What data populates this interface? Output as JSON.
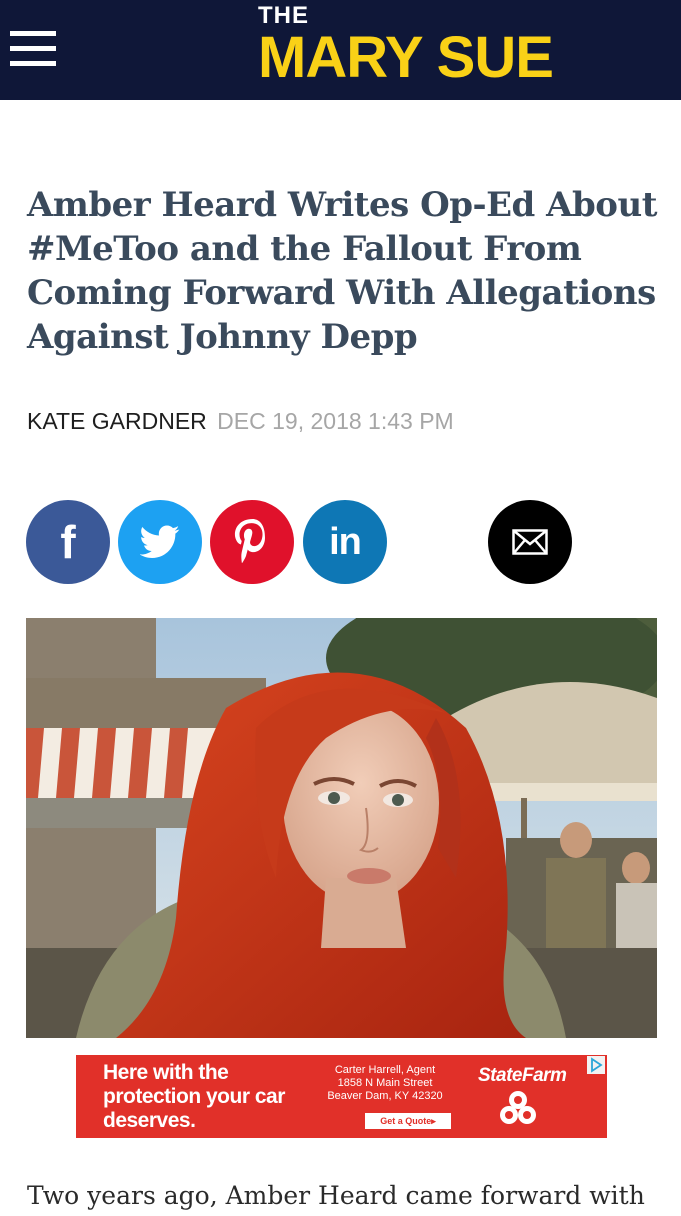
{
  "header": {
    "logo_top": "THE",
    "logo_name": "MARY SUE",
    "colors": {
      "bar": "#0f1738",
      "logo_accent": "#f9d117"
    }
  },
  "article": {
    "title": "Amber Heard Writes Op-Ed About #MeToo and the Fallout From Coming Forward With Allegations Against Johnny Depp",
    "author": "KATE GARDNER",
    "date": "DEC 19, 2018 1:43 PM",
    "body_first_line": "Two years ago, Amber Heard came forward with"
  },
  "share": [
    {
      "network": "facebook",
      "icon": "facebook-icon",
      "color": "#3b5998"
    },
    {
      "network": "twitter",
      "icon": "twitter-bird-icon",
      "color": "#1da1f2"
    },
    {
      "network": "pinterest",
      "icon": "pinterest-icon",
      "color": "#e0112b"
    },
    {
      "network": "linkedin",
      "icon": "linkedin-icon",
      "color": "#0e77b5"
    },
    {
      "network": "email",
      "icon": "envelope-icon",
      "color": "#000000"
    }
  ],
  "icons": {
    "facebook": "f",
    "linkedin": "in"
  },
  "ad": {
    "headline": "Here with the protection your car deserves.",
    "agent_name": "Carter Harrell, Agent",
    "agent_street": "1858 N Main Street",
    "agent_city": "Beaver Dam, KY 42320",
    "cta": "Get a Quote▸",
    "brand": "StateFarm",
    "color": "#e13029"
  }
}
